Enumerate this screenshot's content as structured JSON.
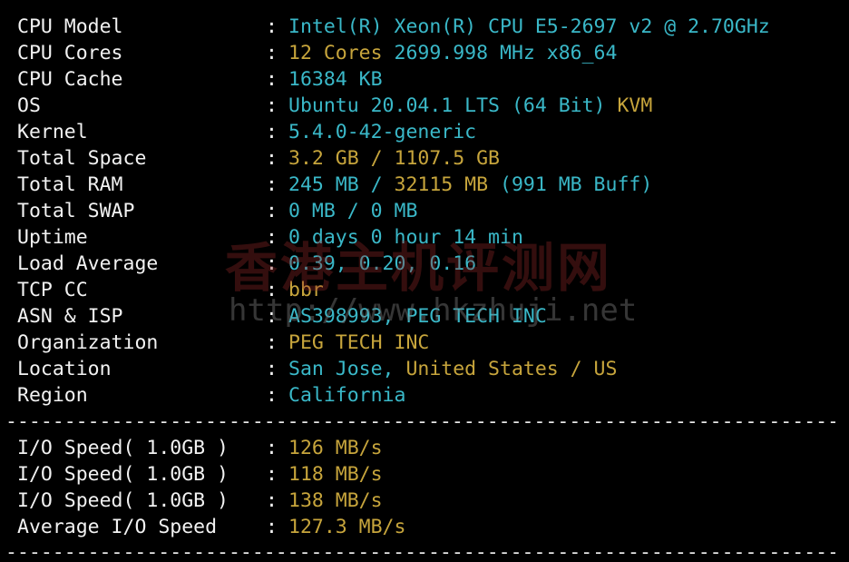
{
  "dividers": {
    "top": "-----------------------------------------------------------------------",
    "middle": "-----------------------------------------------------------------------",
    "bottom": "-----------------------------------------------------------------------"
  },
  "separator": ":",
  "system_info": [
    {
      "label": "CPU Model",
      "parts": [
        {
          "text": "Intel(R) Xeon(R) CPU E5-2697 v2 @ 2.70GHz",
          "color": "cyan"
        }
      ]
    },
    {
      "label": "CPU Cores",
      "parts": [
        {
          "text": "12 Cores ",
          "color": "gold"
        },
        {
          "text": "2699.998 MHz x86_64",
          "color": "cyan"
        }
      ]
    },
    {
      "label": "CPU Cache",
      "parts": [
        {
          "text": "16384 KB",
          "color": "cyan"
        }
      ]
    },
    {
      "label": "OS",
      "parts": [
        {
          "text": "Ubuntu 20.04.1 LTS (64 Bit) ",
          "color": "cyan"
        },
        {
          "text": "KVM",
          "color": "gold"
        }
      ]
    },
    {
      "label": "Kernel",
      "parts": [
        {
          "text": "5.4.0-42-generic",
          "color": "cyan"
        }
      ]
    },
    {
      "label": "Total Space",
      "parts": [
        {
          "text": "3.2 GB / ",
          "color": "gold"
        },
        {
          "text": "1107.5 GB",
          "color": "gold"
        }
      ]
    },
    {
      "label": "Total RAM",
      "parts": [
        {
          "text": "245 MB / ",
          "color": "cyan"
        },
        {
          "text": "32115 MB",
          "color": "gold"
        },
        {
          "text": " (991 MB Buff)",
          "color": "cyan"
        }
      ]
    },
    {
      "label": "Total SWAP",
      "parts": [
        {
          "text": "0 MB / 0 MB",
          "color": "cyan"
        }
      ]
    },
    {
      "label": "Uptime",
      "parts": [
        {
          "text": "0 days 0 hour 14 min",
          "color": "cyan"
        }
      ]
    },
    {
      "label": "Load Average",
      "parts": [
        {
          "text": "0.39, 0.20, 0.16",
          "color": "cyan"
        }
      ]
    },
    {
      "label": "TCP CC",
      "parts": [
        {
          "text": "bbr",
          "color": "gold"
        }
      ]
    },
    {
      "label": "ASN & ISP",
      "parts": [
        {
          "text": "AS398993, PEG TECH INC",
          "color": "cyan"
        }
      ]
    },
    {
      "label": "Organization",
      "parts": [
        {
          "text": "PEG TECH INC",
          "color": "gold"
        }
      ]
    },
    {
      "label": "Location",
      "parts": [
        {
          "text": "San Jose, ",
          "color": "cyan"
        },
        {
          "text": "United States / US",
          "color": "gold"
        }
      ]
    },
    {
      "label": "Region",
      "parts": [
        {
          "text": "California",
          "color": "cyan"
        }
      ]
    }
  ],
  "io_info": [
    {
      "label": "I/O Speed( 1.0GB )",
      "parts": [
        {
          "text": "126 MB/s",
          "color": "gold"
        }
      ]
    },
    {
      "label": "I/O Speed( 1.0GB )",
      "parts": [
        {
          "text": "118 MB/s",
          "color": "gold"
        }
      ]
    },
    {
      "label": "I/O Speed( 1.0GB )",
      "parts": [
        {
          "text": "138 MB/s",
          "color": "gold"
        }
      ]
    },
    {
      "label": "Average I/O Speed",
      "parts": [
        {
          "text": "127.3 MB/s",
          "color": "gold"
        }
      ]
    }
  ],
  "watermark": {
    "title": "香港主机评测网",
    "url": "http://www.hkzhuji.net"
  },
  "colors": {
    "background": "#000000",
    "label": "#f2f2f2",
    "cyan": "#3ab8c8",
    "gold": "#c7a53c"
  }
}
